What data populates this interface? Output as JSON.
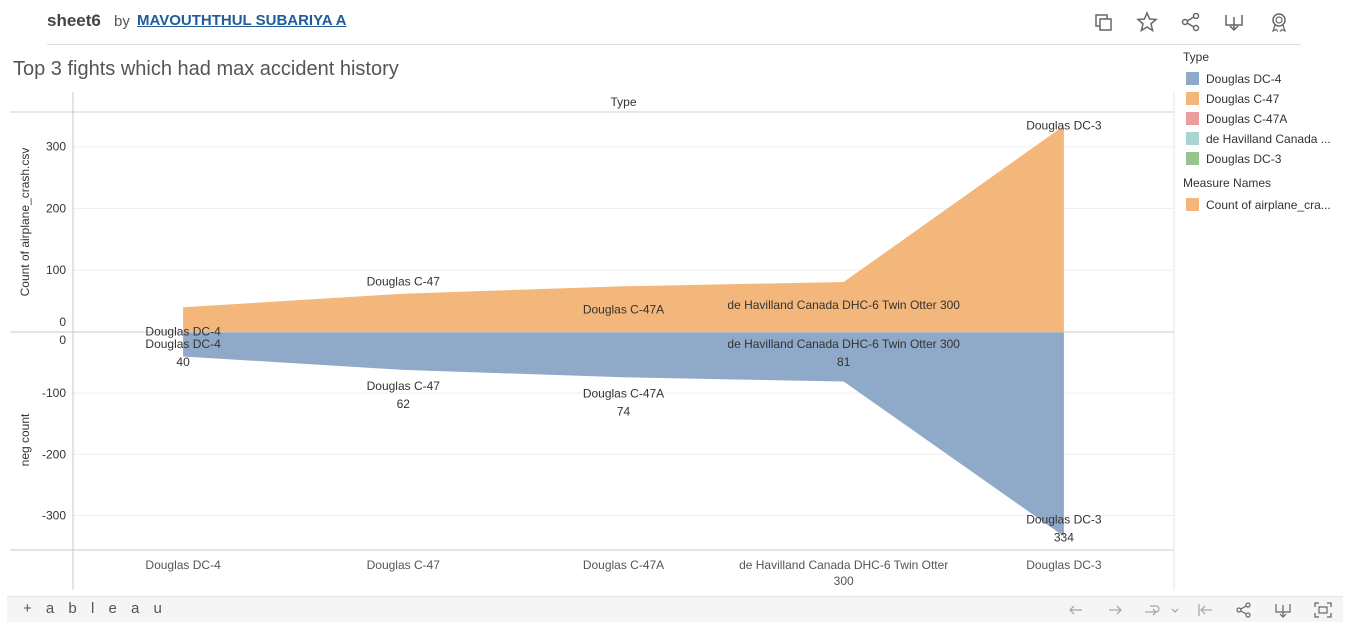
{
  "header": {
    "sheet": "sheet6",
    "by": "by",
    "author": "MAVOUTHTHUL SUBARIYA A",
    "icons": [
      "duplicate-icon",
      "star-icon",
      "share-icon",
      "download-icon",
      "badge-icon"
    ]
  },
  "sheet_title": "Top 3 fights which had max accident history",
  "legend": {
    "type_title": "Type",
    "type_items": [
      {
        "label": "Douglas DC-4",
        "color": "#8fa9c8"
      },
      {
        "label": "Douglas C-47",
        "color": "#f4b77b"
      },
      {
        "label": "Douglas C-47A",
        "color": "#ea9d9d"
      },
      {
        "label": "de Havilland Canada ...",
        "color": "#a9d4cf"
      },
      {
        "label": "Douglas DC-3",
        "color": "#95c48e"
      }
    ],
    "measure_title": "Measure Names",
    "measure_items": [
      {
        "label": "Count of airplane_cra...",
        "color": "#f4b77b"
      }
    ]
  },
  "chart_data": {
    "type": "area",
    "column_header": "Type",
    "categories": [
      "Douglas DC-4",
      "Douglas C-47",
      "Douglas C-47A",
      "de Havilland Canada DHC-6 Twin Otter 300",
      "Douglas DC-3"
    ],
    "category_axis_labels": [
      [
        "Douglas DC-4"
      ],
      [
        "Douglas C-47"
      ],
      [
        "Douglas C-47A"
      ],
      [
        "de Havilland Canada DHC-6 Twin Otter",
        "300"
      ],
      [
        "Douglas DC-3"
      ]
    ],
    "top_panel": {
      "ylabel": "Count of airplane_crash.csv",
      "ylim": [
        0,
        340
      ],
      "ticks": [
        0,
        100,
        200,
        300
      ],
      "series": [
        {
          "name": "Count of airplane_crash.csv",
          "values": [
            40,
            62,
            74,
            81,
            334
          ],
          "color": "#f4b77b"
        }
      ],
      "point_labels": [
        "Douglas DC-4",
        "Douglas C-47",
        "Douglas C-47A",
        "de Havilland Canada DHC-6 Twin Otter 300",
        "Douglas DC-3"
      ]
    },
    "bottom_panel": {
      "ylabel": "neg count",
      "ylim": [
        -345,
        0
      ],
      "ticks": [
        0,
        -100,
        -200,
        -300
      ],
      "series": [
        {
          "name": "neg count",
          "values": [
            -40,
            -62,
            -74,
            -81,
            -334
          ],
          "color": "#8fa9c8"
        }
      ],
      "point_labels": [
        [
          "Douglas DC-4",
          "40"
        ],
        [
          "Douglas C-47",
          "62"
        ],
        [
          "Douglas C-47A",
          "74"
        ],
        [
          "de Havilland Canada DHC-6 Twin Otter 300",
          "81"
        ],
        [
          "Douglas DC-3",
          "334"
        ]
      ]
    },
    "grid": true
  },
  "footer": {
    "brand": "+ a b l e a u",
    "icons": [
      "undo-icon",
      "redo-icon",
      "revert-icon",
      "reset-icon",
      "share-icon",
      "download-icon",
      "fullscreen-icon"
    ]
  }
}
